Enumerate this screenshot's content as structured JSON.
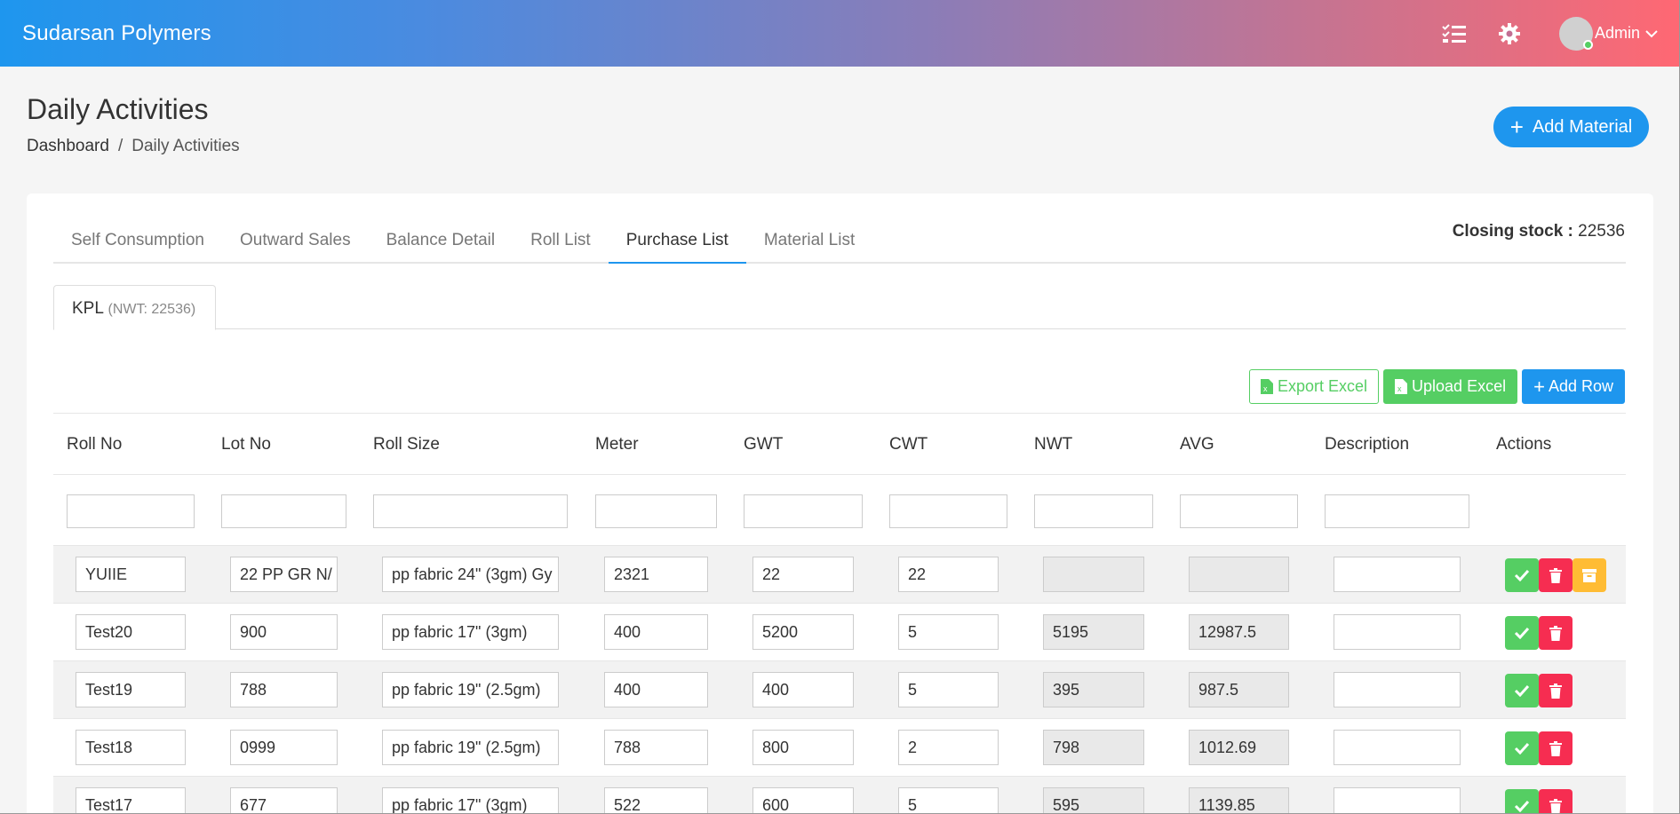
{
  "app": {
    "brand": "Sudarsan Polymers",
    "user": "Admin",
    "icons": [
      "checklist-icon",
      "gear-icon",
      "chevron-down-icon"
    ]
  },
  "page": {
    "title": "Daily Activities",
    "breadcrumb": [
      "Dashboard",
      "Daily Activities"
    ],
    "add_material_label": "Add Material"
  },
  "tabs": [
    "Self Consumption",
    "Outward Sales",
    "Balance Detail",
    "Roll List",
    "Purchase List",
    "Material List"
  ],
  "active_tab": "Purchase List",
  "closing_stock": {
    "label": "Closing stock :",
    "value": "22536"
  },
  "subtab": {
    "label": "KPL",
    "note": "(NWT: 22536)"
  },
  "toolbar": {
    "export_label": "Export Excel",
    "upload_label": "Upload Excel",
    "add_row_label": "Add Row"
  },
  "table": {
    "columns": [
      "Roll No",
      "Lot No",
      "Roll Size",
      "Meter",
      "GWT",
      "CWT",
      "NWT",
      "AVG",
      "Description",
      "Actions"
    ],
    "rows": [
      {
        "roll_no": "YUIIE",
        "lot_no": "22 PP GR N/",
        "roll_size": "pp fabric 24\" (3gm) Gy",
        "meter": "2321",
        "gwt": "22",
        "cwt": "22",
        "nwt": "",
        "avg": "",
        "description": ""
      },
      {
        "roll_no": "Test20",
        "lot_no": "900",
        "roll_size": "pp fabric 17\" (3gm)",
        "meter": "400",
        "gwt": "5200",
        "cwt": "5",
        "nwt": "5195",
        "avg": "12987.5",
        "description": ""
      },
      {
        "roll_no": "Test19",
        "lot_no": "788",
        "roll_size": "pp fabric 19\" (2.5gm)",
        "meter": "400",
        "gwt": "400",
        "cwt": "5",
        "nwt": "395",
        "avg": "987.5",
        "description": ""
      },
      {
        "roll_no": "Test18",
        "lot_no": "0999",
        "roll_size": "pp fabric 19\" (2.5gm)",
        "meter": "788",
        "gwt": "800",
        "cwt": "2",
        "nwt": "798",
        "avg": "1012.69",
        "description": ""
      },
      {
        "roll_no": "Test17",
        "lot_no": "677",
        "roll_size": "pp fabric 17\" (3gm)",
        "meter": "522",
        "gwt": "600",
        "cwt": "5",
        "nwt": "595",
        "avg": "1139.85",
        "description": ""
      }
    ]
  },
  "colors": {
    "primary": "#1e96ee",
    "success": "#55ce63",
    "danger": "#f62d51",
    "warning": "#ffbc34",
    "header_gradient_end": "#ff6873"
  }
}
